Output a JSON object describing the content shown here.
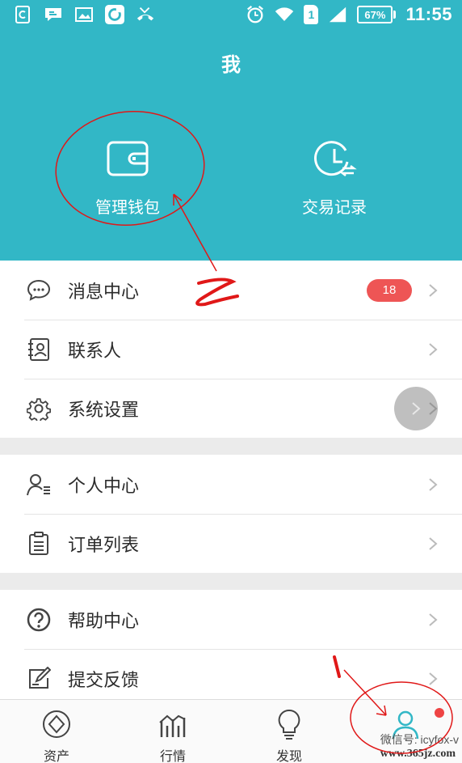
{
  "status_bar": {
    "battery": "67%",
    "sim": "1",
    "time": "11:55"
  },
  "page": {
    "title": "我"
  },
  "header": {
    "wallet_label": "管理钱包",
    "trade_label": "交易记录"
  },
  "menu": {
    "messages": {
      "label": "消息中心",
      "badge": "18"
    },
    "contacts": {
      "label": "联系人"
    },
    "settings": {
      "label": "系统设置"
    },
    "profile": {
      "label": "个人中心"
    },
    "orders": {
      "label": "订单列表"
    },
    "help": {
      "label": "帮助中心"
    },
    "feedback": {
      "label": "提交反馈"
    }
  },
  "tabs": {
    "assets": "资产",
    "market": "行情",
    "discover": "发现",
    "me": ""
  },
  "annotations": {
    "mark_1": "1",
    "mark_2": "Z"
  },
  "watermark": {
    "line1": "微信号: icyfox-v",
    "line2": "www.365jz.com"
  },
  "colors": {
    "accent": "#32b7c6",
    "badge": "#ee5555",
    "annotation": "#e01818"
  }
}
